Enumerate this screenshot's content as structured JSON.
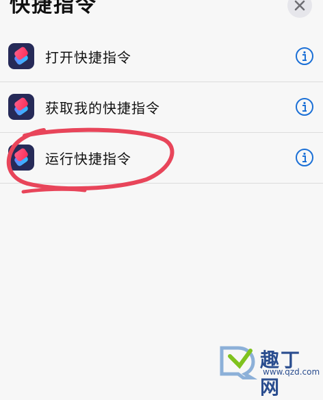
{
  "header": {
    "title": "快捷指令"
  },
  "items": [
    {
      "label": "打开快捷指令"
    },
    {
      "label": "获取我的快捷指令"
    },
    {
      "label": "运行快捷指令"
    }
  ],
  "watermark": {
    "text": "趣丁网",
    "url": "www.qzd.com"
  },
  "colors": {
    "info_accent": "#1a6fd6",
    "annotation": "#e8455a",
    "icon_bg": "#262a58"
  }
}
